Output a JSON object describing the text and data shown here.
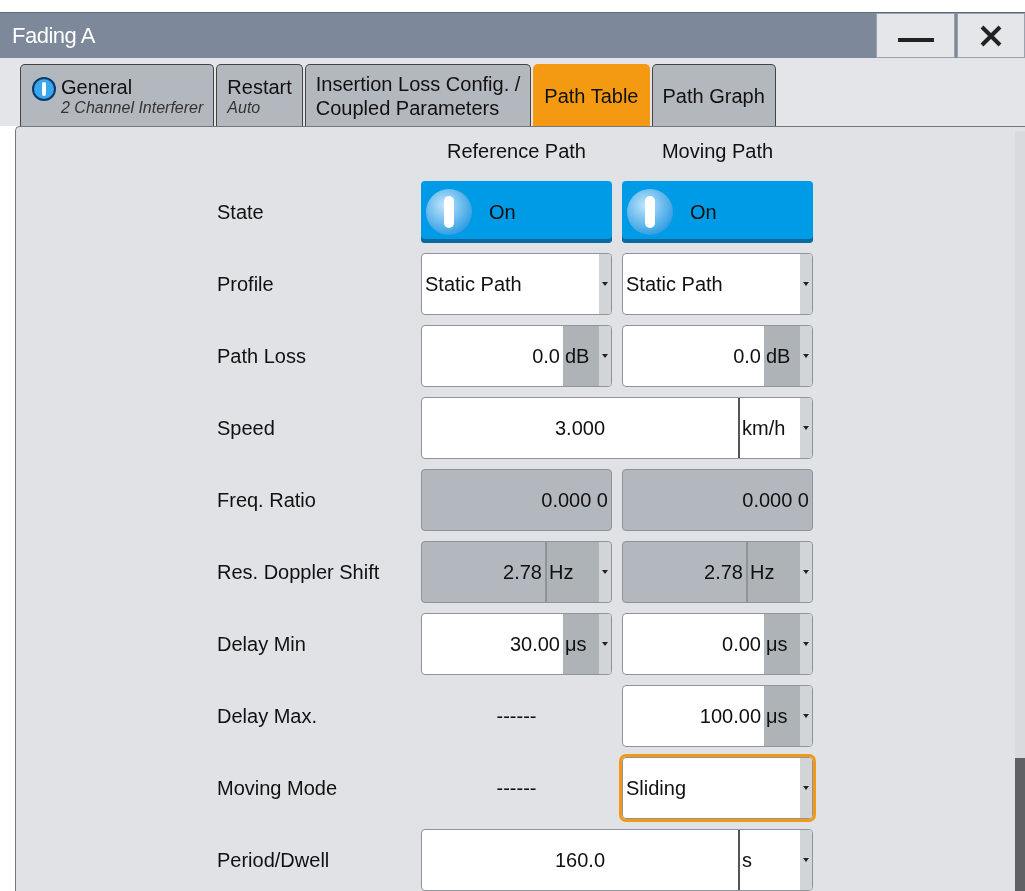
{
  "window": {
    "title": "Fading A"
  },
  "tabs": [
    {
      "label": "General",
      "subtitle": "2 Channel Interferer",
      "selected": false
    },
    {
      "label": "Restart",
      "subtitle": "Auto",
      "selected": false
    },
    {
      "label": "Insertion Loss Config. /\nCoupled Parameters",
      "selected": false
    },
    {
      "label": "Path Table",
      "selected": true
    },
    {
      "label": "Path Graph",
      "selected": false
    }
  ],
  "columns": [
    "Reference Path",
    "Moving Path"
  ],
  "rows": [
    {
      "label": "State",
      "cells": [
        {
          "kind": "toggle",
          "value": "On",
          "on": true
        },
        {
          "kind": "toggle",
          "value": "On",
          "on": true
        }
      ]
    },
    {
      "label": "Profile",
      "cells": [
        {
          "kind": "dropdown",
          "value": "Static Path",
          "focused": false
        },
        {
          "kind": "dropdown",
          "value": "Static Path",
          "focused": false
        }
      ]
    },
    {
      "label": "Path Loss",
      "cells": [
        {
          "kind": "number",
          "value": "0.0",
          "unit": "dB",
          "disabled": false,
          "focused": false
        },
        {
          "kind": "number",
          "value": "0.0",
          "unit": "dB",
          "disabled": false,
          "focused": false
        }
      ]
    },
    {
      "label": "Speed",
      "span": {
        "kind": "number",
        "value": "3.000",
        "unit": "km/h",
        "disabled": false,
        "focused": false
      }
    },
    {
      "label": "Freq. Ratio",
      "cells": [
        {
          "kind": "number",
          "value": "0.000 0",
          "disabled": true,
          "focused": false
        },
        {
          "kind": "number",
          "value": "0.000 0",
          "disabled": true,
          "focused": false
        }
      ]
    },
    {
      "label": "Res. Doppler Shift",
      "cells": [
        {
          "kind": "number",
          "value": "2.78",
          "unit": "Hz",
          "disabled": true,
          "focused": false
        },
        {
          "kind": "number",
          "value": "2.78",
          "unit": "Hz",
          "disabled": true,
          "focused": false
        }
      ]
    },
    {
      "label": "Delay Min",
      "cells": [
        {
          "kind": "number",
          "value": "30.00",
          "unit": "μs",
          "disabled": false,
          "focused": false
        },
        {
          "kind": "number",
          "value": "0.00",
          "unit": "μs",
          "disabled": false,
          "focused": false
        }
      ]
    },
    {
      "label": "Delay Max.",
      "cells": [
        {
          "kind": "dash",
          "value": "------"
        },
        {
          "kind": "number",
          "value": "100.00",
          "unit": "μs",
          "disabled": false,
          "focused": false
        }
      ]
    },
    {
      "label": "Moving Mode",
      "cells": [
        {
          "kind": "dash",
          "value": "------"
        },
        {
          "kind": "dropdown",
          "value": "Sliding",
          "focused": true
        }
      ]
    },
    {
      "label": "Period/Dwell",
      "span": {
        "kind": "number",
        "value": "160.0",
        "unit": "s",
        "disabled": false,
        "focused": false
      }
    }
  ]
}
